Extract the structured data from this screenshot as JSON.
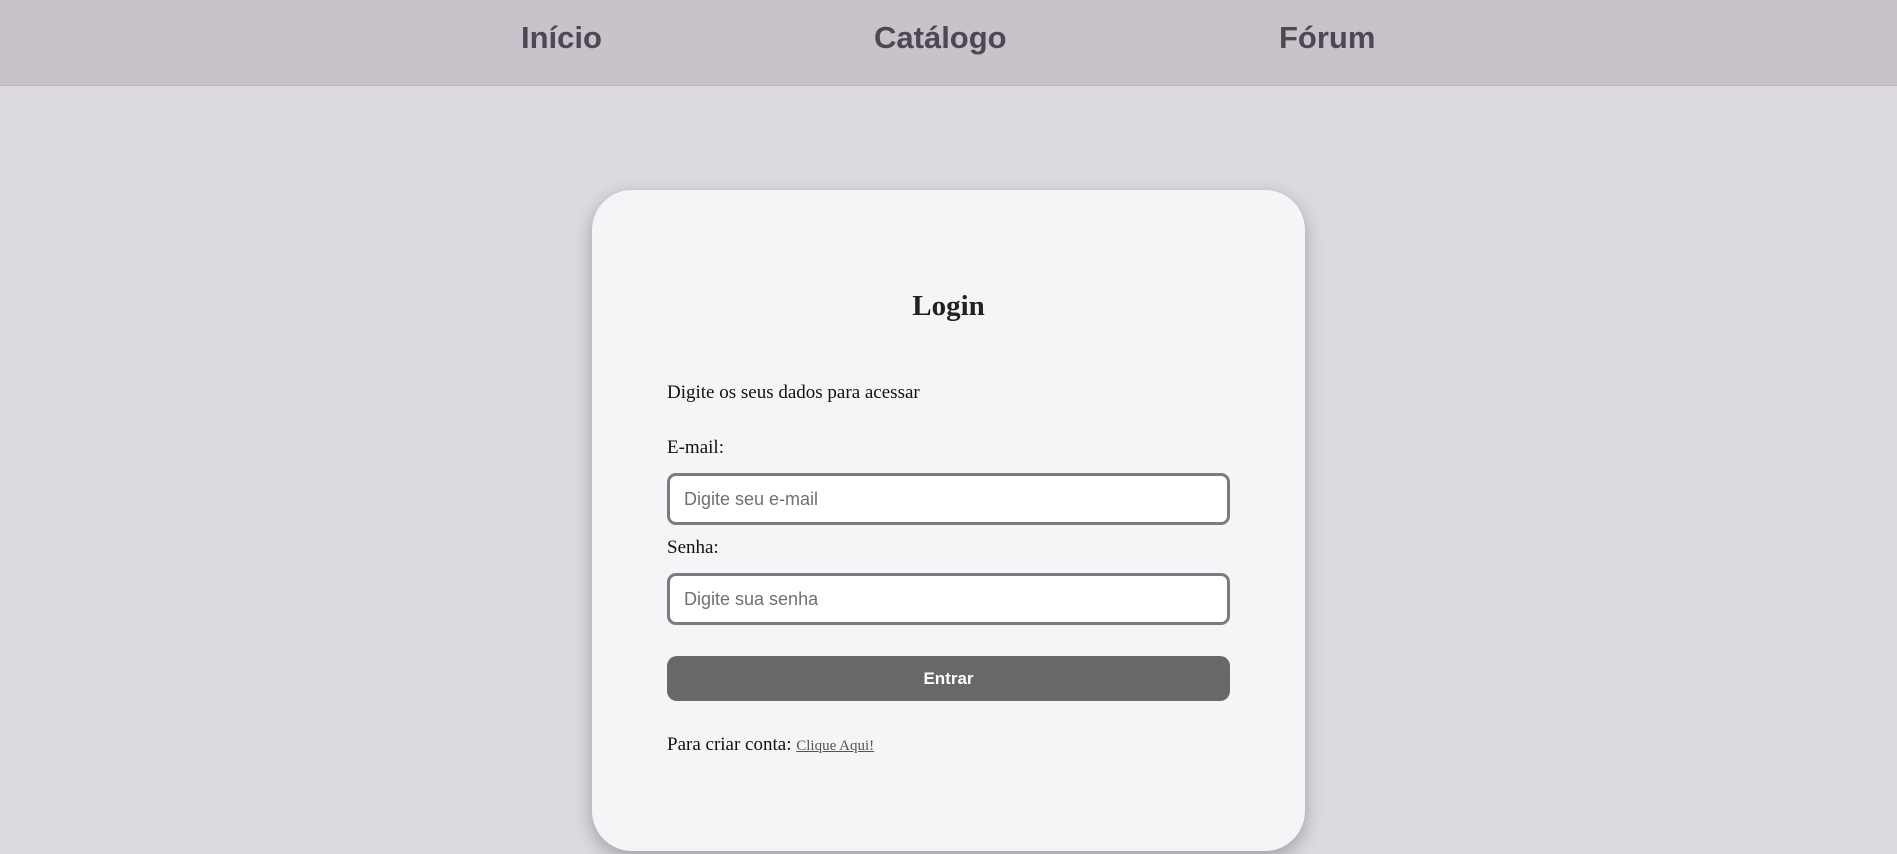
{
  "nav": {
    "items": [
      {
        "label": "Início"
      },
      {
        "label": "Catálogo"
      },
      {
        "label": "Fórum"
      }
    ]
  },
  "login": {
    "title": "Login",
    "subtitle": "Digite os seus dados para acessar",
    "email_label": "E-mail:",
    "email_placeholder": "Digite seu e-mail",
    "email_value": "",
    "password_label": "Senha:",
    "password_placeholder": "Digite sua senha",
    "password_value": "",
    "submit_label": "Entrar",
    "signup_prompt": "Para criar conta: ",
    "signup_link": "Clique Aqui!"
  },
  "colors": {
    "page_background": "#dcdadf",
    "nav_background": "#c8c3ca",
    "nav_text": "#4f4752",
    "card_background": "#f5f4f6",
    "button_background": "#686868"
  }
}
